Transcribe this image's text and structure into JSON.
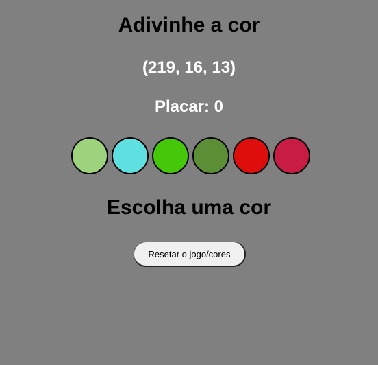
{
  "header": {
    "title": "Adivinhe a cor",
    "target_rgb": "(219, 16, 13)",
    "score_label": "Placar: 0"
  },
  "colors": [
    "#9dd37c",
    "#5ee0e1",
    "#45c70a",
    "#5b8e35",
    "#dd0e0c",
    "#c91c45"
  ],
  "message": "Escolha uma cor",
  "reset_button_label": "Resetar o jogo/cores"
}
